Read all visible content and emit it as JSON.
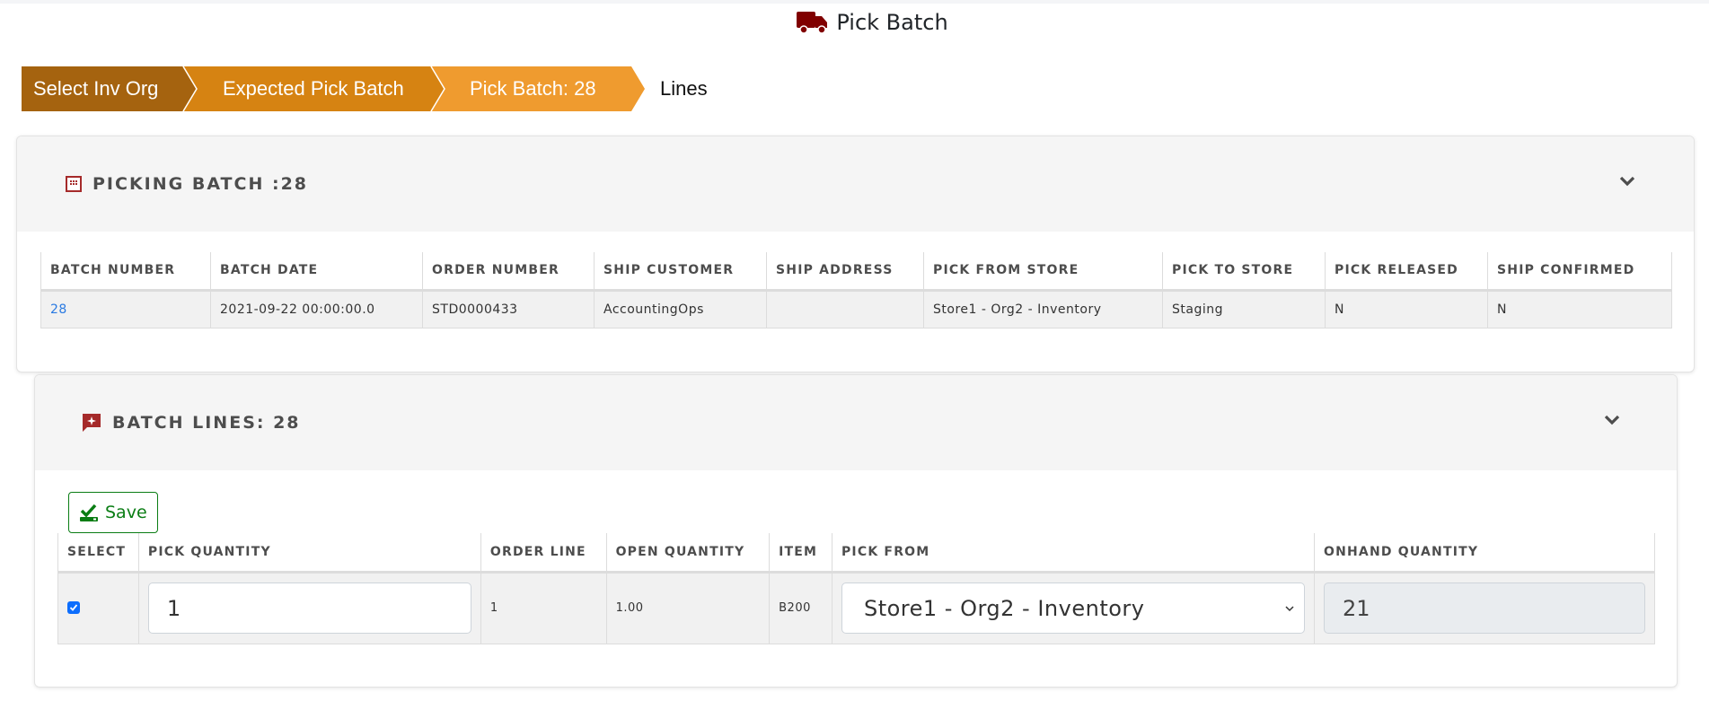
{
  "header": {
    "title": "Pick Batch",
    "icon": "truck-icon"
  },
  "breadcrumb": [
    {
      "label": "Select Inv Org",
      "color": "#a5630f"
    },
    {
      "label": "Expected Pick Batch",
      "color": "#d68312"
    },
    {
      "label": "Pick Batch: 28",
      "color": "#ef9b2f"
    },
    {
      "label": "Lines"
    }
  ],
  "picking_batch": {
    "title": "PICKING BATCH :28",
    "icon": "calendar-icon",
    "toggle_icon": "chevron-down-icon",
    "columns": [
      "BATCH NUMBER",
      "BATCH DATE",
      "ORDER NUMBER",
      "SHIP CUSTOMER",
      "SHIP ADDRESS",
      "PICK FROM STORE",
      "PICK TO STORE",
      "PICK RELEASED",
      "SHIP CONFIRMED"
    ],
    "rows": [
      {
        "batch_number": "28",
        "batch_date": "2021-09-22 00:00:00.0",
        "order_number": "STD0000433",
        "ship_customer": "AccountingOps",
        "ship_address": "",
        "pick_from_store": "Store1 - Org2 - Inventory",
        "pick_to_store": "Staging",
        "pick_released": "N",
        "ship_confirmed": "N"
      }
    ]
  },
  "batch_lines": {
    "title": "BATCH LINES: 28",
    "icon": "comment-star-icon",
    "toggle_icon": "chevron-down-icon",
    "save_label": "Save",
    "columns": [
      "SELECT",
      "PICK QUANTITY",
      "ORDER LINE",
      "OPEN QUANTITY",
      "ITEM",
      "PICK FROM",
      "ONHAND QUANTITY"
    ],
    "rows": [
      {
        "selected": true,
        "pick_quantity": "1",
        "order_line": "1",
        "open_quantity": "1.00",
        "item": "B200",
        "pick_from": "Store1 - Org2 - Inventory",
        "onhand_quantity": "21"
      }
    ]
  },
  "colors": {
    "accent_red": "#8b0000",
    "save_green": "#0a7d14",
    "link_blue": "#2a7ae2"
  }
}
